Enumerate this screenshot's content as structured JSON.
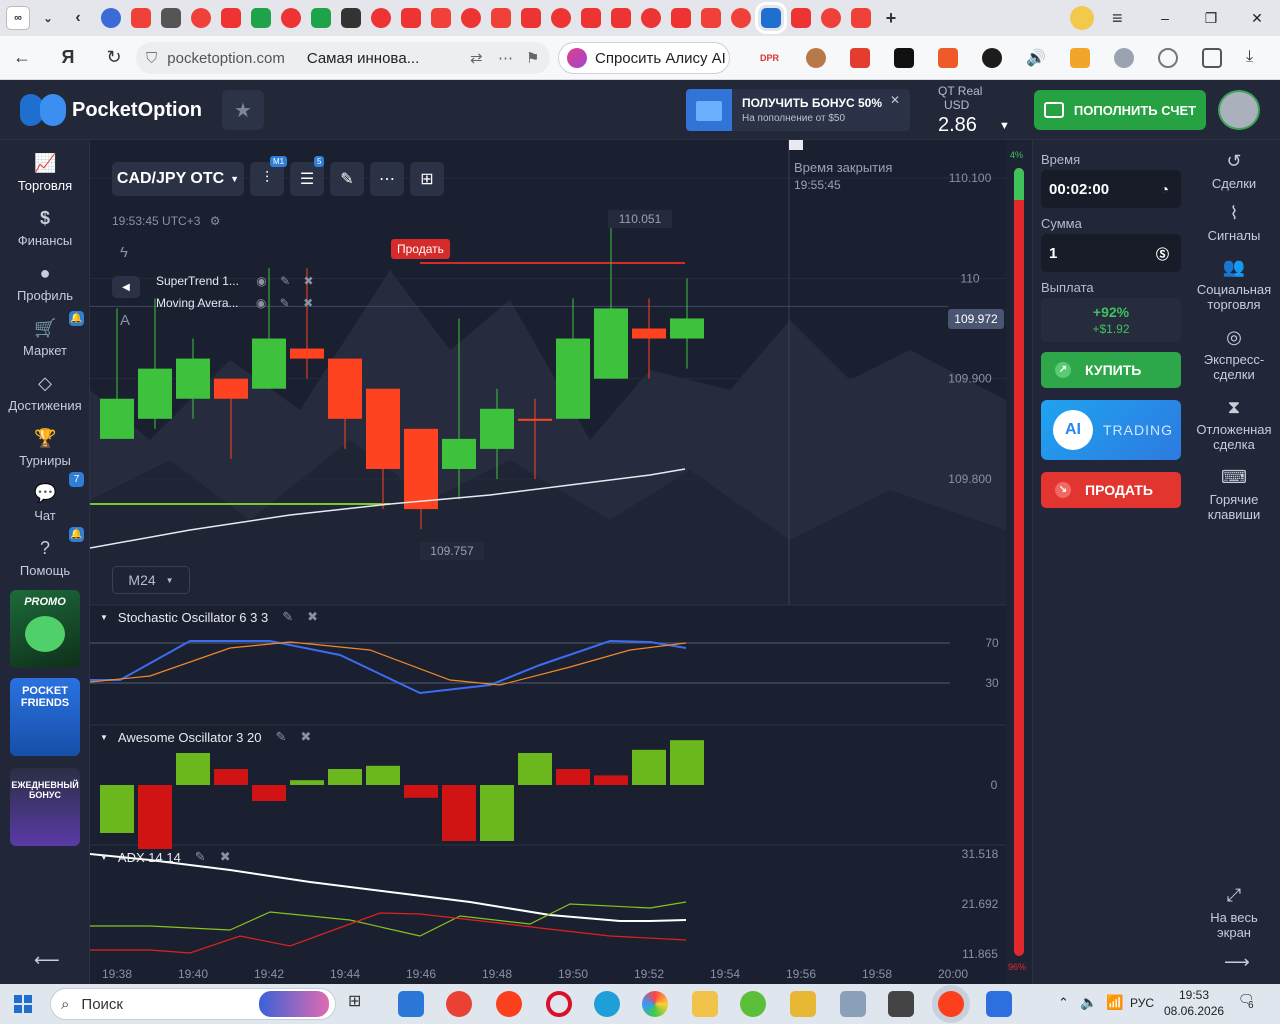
{
  "browser": {
    "url": "pocketoption.com",
    "page_title": "Самая инновa...",
    "alice_label": "Спросить Алису AI",
    "ext_label_dpr": "DPR"
  },
  "header": {
    "brand": "PocketOption",
    "bonus_title": "ПОЛУЧИТЬ БОНУС 50%",
    "bonus_sub": "На пополнение от $50",
    "account_type": "QT Real",
    "currency": "USD",
    "balance": "2.86",
    "topup_label": "ПОПОЛНИТЬ СЧЕТ"
  },
  "sidebar": {
    "items": [
      {
        "label": "Торговля",
        "badge": ""
      },
      {
        "label": "Финансы",
        "badge": ""
      },
      {
        "label": "Профиль",
        "badge": ""
      },
      {
        "label": "Маркет",
        "badge": "🔔"
      },
      {
        "label": "Достижения",
        "badge": ""
      },
      {
        "label": "Турниры",
        "badge": ""
      },
      {
        "label": "Чат",
        "badge": "7"
      },
      {
        "label": "Помощь",
        "badge": "🔔"
      }
    ],
    "promo": "PROMO",
    "friends": "POCKET FRIENDS",
    "daily": "ЕЖЕДНЕВНЫЙ БОНУС"
  },
  "chart_toolbar": {
    "pair": "CAD/JPY OTC",
    "timeframe_badge": "M1",
    "indicators_badge": "5",
    "clock": "19:53:45 UTC+3",
    "zoom": "M24",
    "close_label": "Время закрытия",
    "close_time": "19:55:45"
  },
  "indicators": {
    "list": [
      "SuperTrend 1...",
      "Moving Avera..."
    ],
    "stoch_title": "Stochastic Oscillator  6 3 3",
    "ao_title": "Awesome Oscillator  3 20",
    "adx_title": "ADX  14 14"
  },
  "chart_data": {
    "type": "candlestick",
    "pair": "CAD/JPY OTC",
    "x": [
      "19:38",
      "19:40",
      "19:42",
      "19:44",
      "19:46",
      "19:48",
      "19:50",
      "19:52",
      "19:54",
      "19:56",
      "19:58",
      "20:00"
    ],
    "price_axis": [
      "110.100",
      "110",
      "109.900",
      "109.800"
    ],
    "current_price": "109.972",
    "high_label": "110.051",
    "low_label": "109.757",
    "sell_marker": "Продать",
    "candles": [
      {
        "o": 109.84,
        "c": 109.88,
        "h": 109.97,
        "l": 109.84
      },
      {
        "o": 109.86,
        "c": 109.91,
        "h": 109.98,
        "l": 109.85
      },
      {
        "o": 109.88,
        "c": 109.92,
        "h": 109.94,
        "l": 109.86
      },
      {
        "o": 109.9,
        "c": 109.88,
        "h": 109.9,
        "l": 109.82
      },
      {
        "o": 109.89,
        "c": 109.94,
        "h": 110.01,
        "l": 109.89
      },
      {
        "o": 109.93,
        "c": 109.92,
        "h": 110.01,
        "l": 109.9
      },
      {
        "o": 109.92,
        "c": 109.86,
        "h": 109.92,
        "l": 109.83
      },
      {
        "o": 109.89,
        "c": 109.81,
        "h": 109.89,
        "l": 109.77
      },
      {
        "o": 109.85,
        "c": 109.77,
        "h": 109.85,
        "l": 109.75
      },
      {
        "o": 109.81,
        "c": 109.84,
        "h": 109.96,
        "l": 109.78
      },
      {
        "o": 109.83,
        "c": 109.87,
        "h": 109.89,
        "l": 109.8
      },
      {
        "o": 109.86,
        "c": 109.86,
        "h": 109.88,
        "l": 109.8
      },
      {
        "o": 109.86,
        "c": 109.94,
        "h": 109.98,
        "l": 109.86
      },
      {
        "o": 109.9,
        "c": 109.97,
        "h": 110.05,
        "l": 109.9
      },
      {
        "o": 109.95,
        "c": 109.94,
        "h": 109.98,
        "l": 109.9
      },
      {
        "o": 109.94,
        "c": 109.96,
        "h": 110.0,
        "l": 109.91
      }
    ],
    "stoch_levels": [
      "70",
      "30"
    ],
    "ao_zero": "0",
    "adx_axis": [
      "31.518",
      "21.692",
      "11.865"
    ],
    "ao_values": [
      -3,
      -4,
      2,
      1,
      -1,
      0.3,
      1,
      1.2,
      -0.8,
      -3.5,
      -3.5,
      2,
      1,
      0.6,
      2.2,
      2.8
    ]
  },
  "progress": {
    "top": "4%",
    "bottom": "96%"
  },
  "trade": {
    "time_label": "Время",
    "time_value": "00:02:00",
    "amount_label": "Сумма",
    "amount_value": "1",
    "payout_label": "Выплата",
    "payout_pct": "+92%",
    "payout_usd": "+$1.92",
    "buy": "КУПИТЬ",
    "ai": "TRADING",
    "ai_badge": "AI",
    "sell": "ПРОДАТЬ"
  },
  "right_sidebar": {
    "items": [
      "Сделки",
      "Сигналы",
      "Социальная торговля",
      "Экспресс-сделки",
      "Отложенная сделка",
      "Горячие клавиши",
      "На весь экран"
    ]
  },
  "taskbar": {
    "search": "Поиск",
    "lang": "РУС",
    "time": "19:53",
    "date": "08.06.2026",
    "notif": "6"
  }
}
